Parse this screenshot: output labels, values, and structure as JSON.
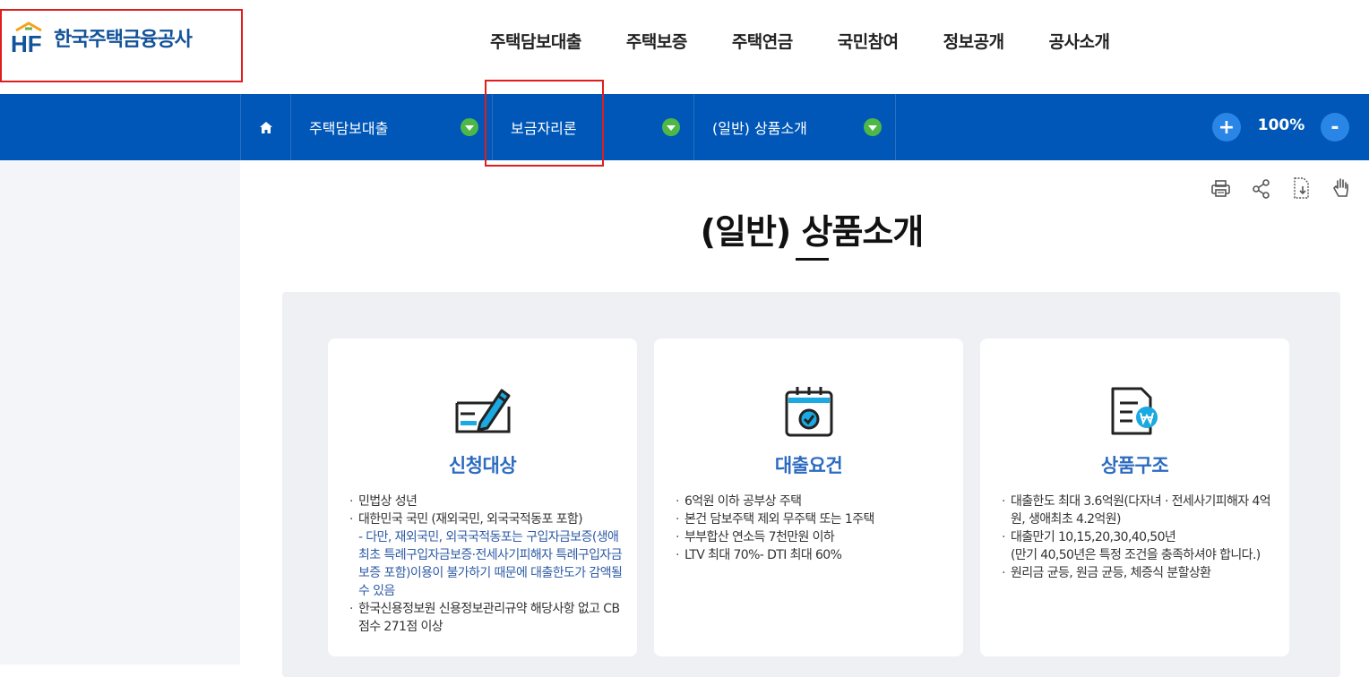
{
  "header": {
    "logo_text": "한국주택금융공사",
    "logo_mark": "HF",
    "nav": [
      "주택담보대출",
      "주택보증",
      "주택연금",
      "국민참여",
      "정보공개",
      "공사소개"
    ]
  },
  "breadcrumb": {
    "home_icon": "home-icon",
    "items": [
      "주택담보대출",
      "보금자리론",
      "(일반) 상품소개"
    ]
  },
  "zoom": {
    "plus": "+",
    "minus": "-",
    "level": "100%"
  },
  "tools": [
    "print-icon",
    "share-icon",
    "download-icon",
    "hand-icon"
  ],
  "page": {
    "title": "(일반) 상품소개"
  },
  "cards": [
    {
      "title": "신청대상",
      "icon": "pen-form-icon",
      "items": [
        "민법상 성년",
        "대한민국 국민 (재외국민, 외국국적동포 포함)",
        "한국신용정보원 신용정보관리규약 해당사항 없고 CB점수 271점 이상"
      ],
      "note": "- 다만, 재외국민, 외국국적동포는 구입자금보증(생애최초 특례구입자금보증·전세사기피해자 특례구입자금보증 포함)이용이 불가하기 때문에 대출한도가 감액될 수 있음"
    },
    {
      "title": "대출요건",
      "icon": "calendar-check-icon",
      "items": [
        "6억원 이하 공부상 주택",
        "본건 담보주택 제외 무주택 또는 1주택",
        "부부합산 연소득 7천만원 이하",
        "LTV 최대 70%- DTI 최대 60%"
      ]
    },
    {
      "title": "상품구조",
      "icon": "document-won-icon",
      "items": [
        "대출한도 최대 3.6억원(다자녀 · 전세사기피해자 4억원, 생애최초 4.2억원)",
        "대출만기 10,15,20,30,40,50년",
        "원리금 균등, 원금 균등, 체증식 분할상환"
      ],
      "sub": "(만기 40,50년은 특정 조건을 충족하셔야 합니다.)"
    }
  ],
  "colors": {
    "brand_blue": "#0057b7",
    "accent_green": "#4db848",
    "highlight_red": "#e01d1d",
    "card_title": "#2c6bc0"
  }
}
